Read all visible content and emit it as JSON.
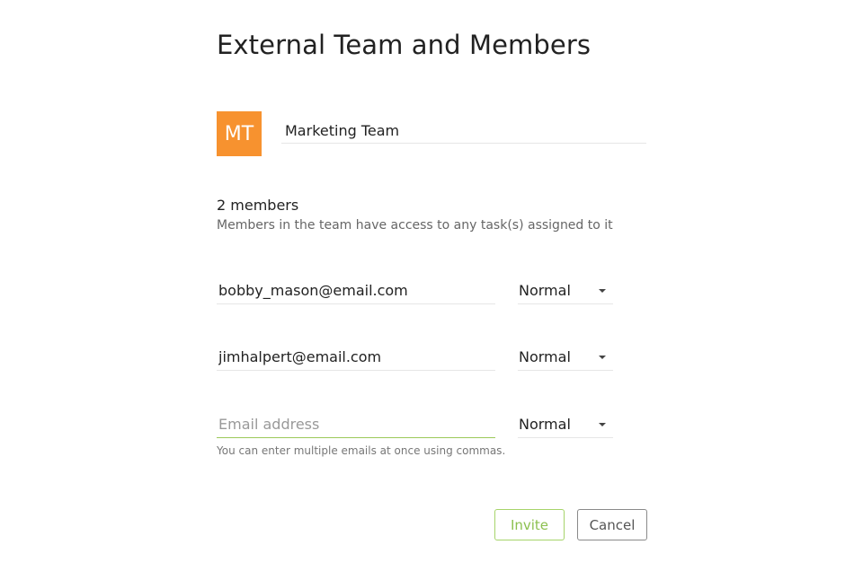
{
  "title": "External Team and Members",
  "team": {
    "initials": "MT",
    "name": "Marketing Team",
    "avatar_color": "#f7922f"
  },
  "members_section": {
    "count_label": "2 members",
    "description": "Members in the team have access to any task(s) assigned to it"
  },
  "members": [
    {
      "email": "bobby_mason@email.com",
      "role": "Normal"
    },
    {
      "email": "jimhalpert@email.com",
      "role": "Normal"
    }
  ],
  "new_member": {
    "placeholder": "Email address",
    "value": "",
    "role": "Normal",
    "hint": "You can enter multiple emails at once using commas."
  },
  "actions": {
    "invite_label": "Invite",
    "cancel_label": "Cancel",
    "invite_color": "#8cc04f"
  },
  "icons": {
    "role_dropdown": "caret-down-icon"
  }
}
